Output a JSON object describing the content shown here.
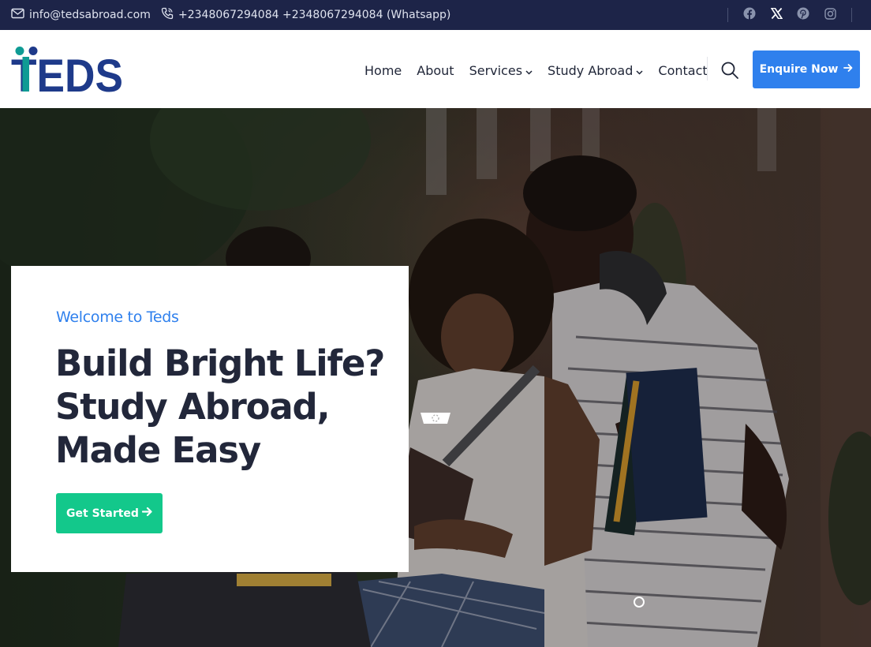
{
  "topbar": {
    "email": "info@tedsabroad.com",
    "phone": "+2348067294084 +2348067294084 (Whatsapp)",
    "social": [
      "facebook-icon",
      "x-icon",
      "pinterest-icon",
      "instagram-icon"
    ]
  },
  "logo": {
    "text": "TEDS"
  },
  "nav": {
    "items": [
      "Home",
      "About",
      "Services",
      "Study Abroad",
      "Contact"
    ],
    "enquire_label": "Enquire Now"
  },
  "hero": {
    "eyebrow": "Welcome to Teds",
    "headline_lines": [
      "Build Bright Life?",
      "Study Abroad,",
      "Made Easy"
    ],
    "cta_label": "Get Started"
  },
  "colors": {
    "topbar": "#1d2448",
    "logo_navy": "#1e3a8a",
    "logo_teal": "#0f9b94",
    "accent_blue": "#2f80ed",
    "accent_green": "#13c88b",
    "heading": "#22273a"
  }
}
